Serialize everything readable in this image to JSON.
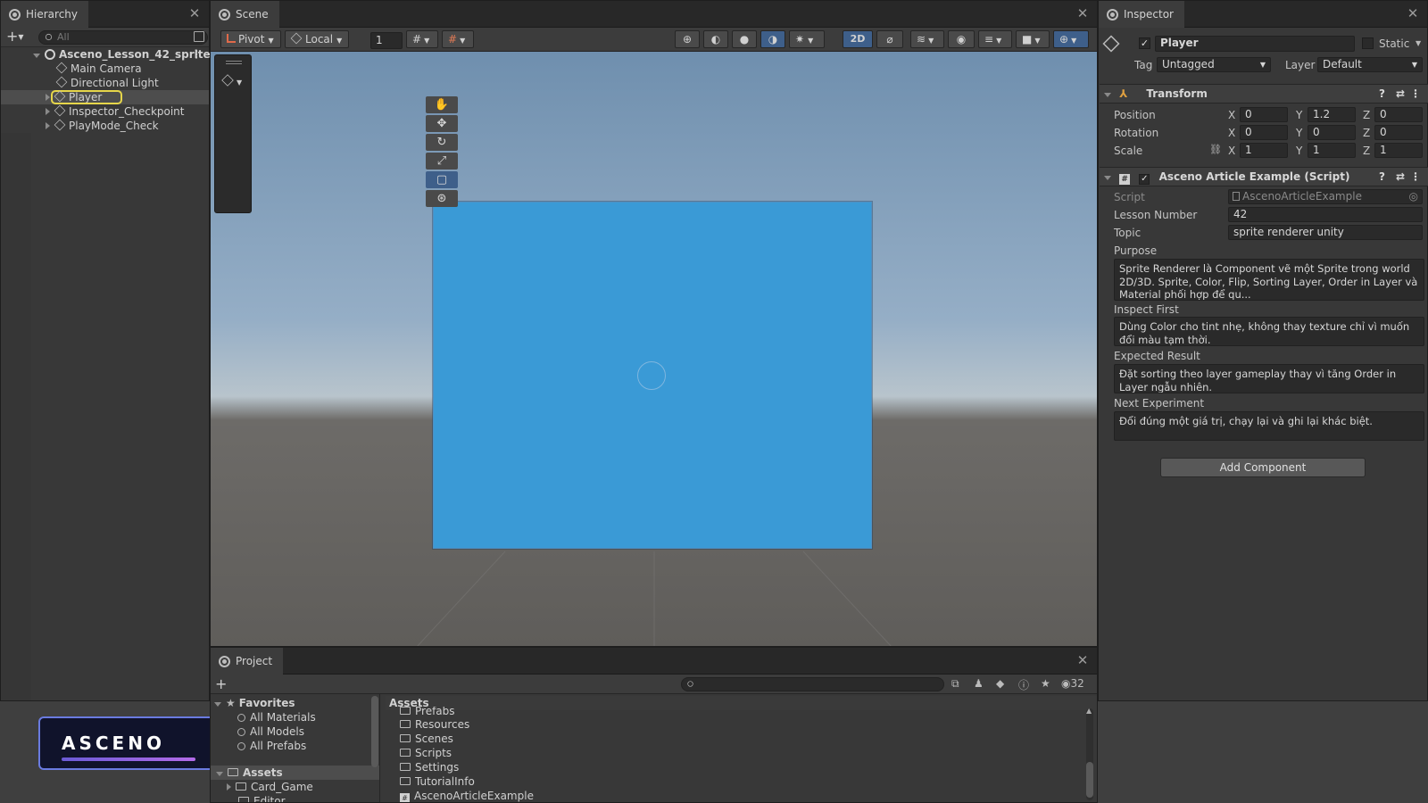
{
  "hierarchy": {
    "tab_title": "Hierarchy",
    "search_placeholder": "All",
    "scene_name": "Asceno_Lesson_42_sprite",
    "items": [
      {
        "label": "Main Camera"
      },
      {
        "label": "Directional Light"
      },
      {
        "label": "Player"
      },
      {
        "label": "Inspector_Checkpoint"
      },
      {
        "label": "PlayMode_Check"
      }
    ]
  },
  "scene": {
    "tab_title": "Scene",
    "pivot_label": "Pivot",
    "local_label": "Local",
    "grid_value": "1",
    "mode_2d_label": "2D",
    "sprite_color": "#3a9ad6"
  },
  "inspector": {
    "tab_title": "Inspector",
    "object_name": "Player",
    "static_label": "Static",
    "tag_label": "Tag",
    "tag_value": "Untagged",
    "layer_label": "Layer",
    "layer_value": "Default",
    "transform": {
      "title": "Transform",
      "rows": [
        {
          "label": "Position",
          "x": "0",
          "y": "1.2",
          "z": "0"
        },
        {
          "label": "Rotation",
          "x": "0",
          "y": "0",
          "z": "0"
        },
        {
          "label": "Scale",
          "x": "1",
          "y": "1",
          "z": "1"
        }
      ],
      "axis_x": "X",
      "axis_y": "Y",
      "axis_z": "Z"
    },
    "script": {
      "title": "Asceno Article Example (Script)",
      "script_label": "Script",
      "script_value": "AscenoArticleExample",
      "lesson_label": "Lesson Number",
      "lesson_value": "42",
      "topic_label": "Topic",
      "topic_value": "sprite renderer unity",
      "purpose_label": "Purpose",
      "purpose_value": "Sprite Renderer là Component vẽ một Sprite trong world 2D/3D. Sprite, Color, Flip, Sorting Layer, Order in Layer và Material phối hợp để qu...",
      "inspect_label": "Inspect First",
      "inspect_value": "Dùng Color cho tint nhẹ, không thay texture chỉ vì muốn đổi màu tạm thời.",
      "expected_label": "Expected Result",
      "expected_value": "Đặt sorting theo layer gameplay thay vì tăng Order in Layer ngẫu nhiên.",
      "next_label": "Next Experiment",
      "next_value": "Đổi đúng một giá trị, chạy lại và ghi lại khác biệt."
    },
    "add_component_label": "Add Component"
  },
  "project": {
    "tab_title": "Project",
    "count": "32",
    "favorites_label": "Favorites",
    "favorites": [
      {
        "label": "All Materials"
      },
      {
        "label": "All Models"
      },
      {
        "label": "All Prefabs"
      }
    ],
    "assets_label": "Assets",
    "assets_tree": [
      {
        "label": "Card_Game"
      },
      {
        "label": "Editor"
      }
    ],
    "assets_header": "Assets",
    "asset_items": [
      {
        "label": "Prefabs"
      },
      {
        "label": "Resources"
      },
      {
        "label": "Scenes"
      },
      {
        "label": "Scripts"
      },
      {
        "label": "Settings"
      },
      {
        "label": "TutorialInfo"
      },
      {
        "label": "AscenoArticleExample"
      }
    ]
  },
  "brand": {
    "logo_text": "ASCENO"
  }
}
